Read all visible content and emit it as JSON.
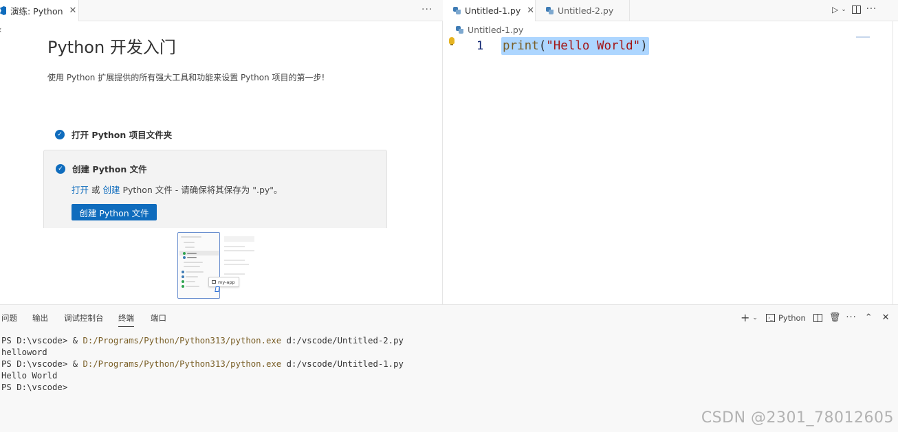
{
  "left_editor": {
    "tab": {
      "icon": "vscode-icon",
      "label": "演练: Python",
      "close": "✕"
    },
    "more": "···",
    "walkthrough": {
      "title": "Python 开发入门",
      "description": "使用 Python 扩展提供的所有强大工具和功能来设置 Python 项目的第一步!",
      "steps": [
        {
          "label": "打开 Python 项目文件夹",
          "done": true
        },
        {
          "label": "创建 Python 文件",
          "done": true,
          "detail": {
            "link1": "打开",
            "or": "或",
            "link2": "创建",
            "rest": "Python 文件 - 请确保将其保存为 \".py\"。"
          },
          "button": "创建 Python 文件"
        }
      ],
      "illustration_chip": "my-app"
    }
  },
  "right_editor": {
    "tabs": [
      {
        "label": "Untitled-1.py",
        "active": true,
        "close": "✕"
      },
      {
        "label": "Untitled-2.py",
        "active": false
      }
    ],
    "breadcrumb": "Untitled-1.py",
    "code": {
      "line_number": "1",
      "fn": "print",
      "open": "(",
      "str": "\"Hello World\"",
      "close": ")"
    }
  },
  "panel": {
    "tabs": [
      "问题",
      "输出",
      "调试控制台",
      "终端",
      "端口"
    ],
    "active_tab": "终端",
    "terminal_profile": "Python",
    "terminal_lines": [
      {
        "prompt": "PS D:\\vscode> & ",
        "path": "D:/Programs/Python/Python313/python.exe",
        "arg": " d:/vscode/Untitled-2.py"
      },
      {
        "text": "helloword"
      },
      {
        "prompt": "PS D:\\vscode> & ",
        "path": "D:/Programs/Python/Python313/python.exe",
        "arg": " d:/vscode/Untitled-1.py"
      },
      {
        "text": "Hello World"
      },
      {
        "text": "PS D:\\vscode>"
      }
    ]
  },
  "watermark": "CSDN @2301_78012605",
  "colors": {
    "accent": "#0f6cbd",
    "selection": "#add6ff",
    "string": "#a31515",
    "function": "#795e26"
  }
}
